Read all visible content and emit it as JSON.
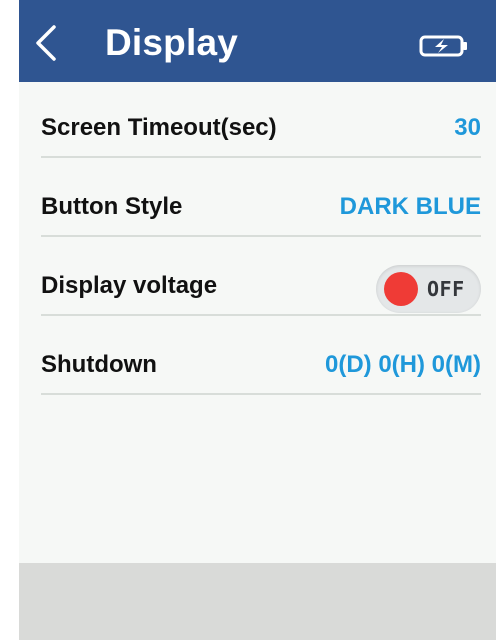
{
  "header": {
    "title": "Display",
    "back_icon": "chevron-left-icon",
    "battery_icon": "battery-charging-icon"
  },
  "settings": [
    {
      "label": "Screen Timeout(sec)",
      "value": "30"
    },
    {
      "label": "Button Style",
      "value": "DARK BLUE"
    },
    {
      "label": "Display voltage",
      "toggle": {
        "state": "OFF",
        "on": false
      }
    },
    {
      "label": "Shutdown",
      "value": "0(D) 0(H) 0(M)"
    }
  ],
  "colors": {
    "header_bg": "#2f5591",
    "value_text": "#1f98da",
    "toggle_off_knob": "#ef3b36",
    "footer_bg": "#d9dad8"
  }
}
